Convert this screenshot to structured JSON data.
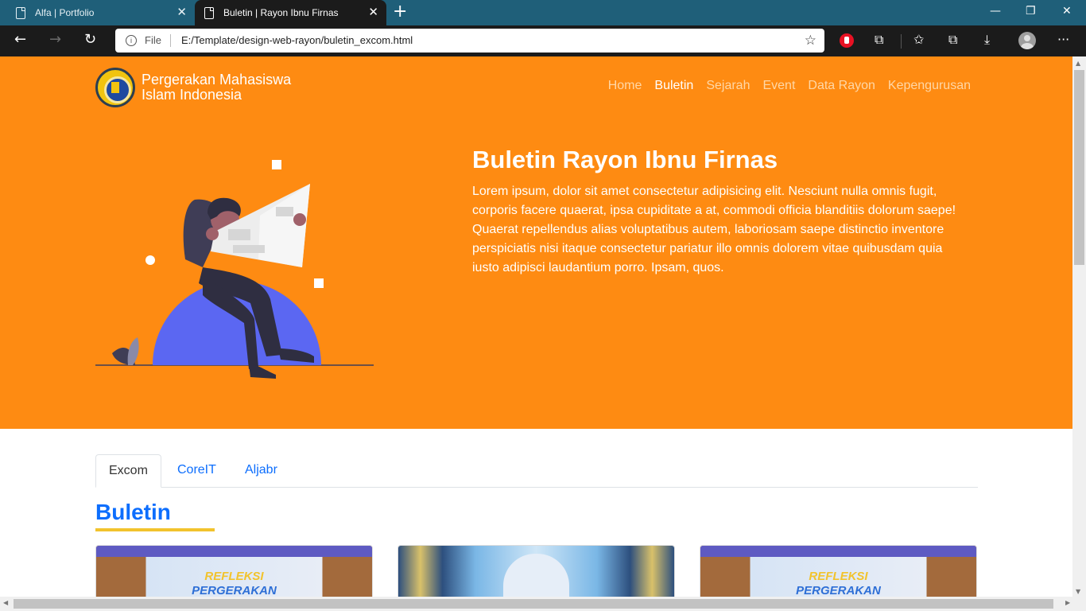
{
  "browser": {
    "tabs": [
      {
        "title": "Alfa | Portfolio",
        "active": false
      },
      {
        "title": "Buletin | Rayon Ibnu Firnas",
        "active": true
      }
    ],
    "address": {
      "scheme_label": "File",
      "url": "E:/Template/design-web-rayon/buletin_excom.html"
    }
  },
  "site": {
    "brand": {
      "line1": "Pergerakan Mahasiswa",
      "line2": "Islam Indonesia"
    },
    "nav": [
      {
        "label": "Home",
        "active": false
      },
      {
        "label": "Buletin",
        "active": true
      },
      {
        "label": "Sejarah",
        "active": false
      },
      {
        "label": "Event",
        "active": false
      },
      {
        "label": "Data Rayon",
        "active": false
      },
      {
        "label": "Kepengurusan",
        "active": false
      }
    ],
    "hero": {
      "title": "Buletin Rayon Ibnu Firnas",
      "text": "Lorem ipsum, dolor sit amet consectetur adipisicing elit. Nesciunt nulla omnis fugit, corporis facere quaerat, ipsa cupiditate a at, commodi officia blanditiis dolorum saepe! Quaerat repellendus alias voluptatibus autem, laboriosam saepe distinctio inventore perspiciatis nisi itaque consectetur pariatur illo omnis dolorem vitae quibusdam quia iusto adipisci laudantium porro. Ipsam, quos."
    },
    "content_tabs": [
      {
        "label": "Excom",
        "active": true
      },
      {
        "label": "CoreIT",
        "active": false
      },
      {
        "label": "Aljabr",
        "active": false
      }
    ],
    "section_title": "Buletin",
    "cards": [
      {
        "line1": "REFLEKSI",
        "line2": "PERGERAKAN"
      },
      {
        "line1": "",
        "line2": ""
      },
      {
        "line1": "REFLEKSI",
        "line2": "PERGERAKAN"
      }
    ]
  },
  "colors": {
    "hero_bg": "#fe8b12",
    "accent_blue": "#0d6efd",
    "underline_yellow": "#f2c32d",
    "chrome_dark": "#1b1b1b",
    "tabbar": "#1f5f79"
  }
}
